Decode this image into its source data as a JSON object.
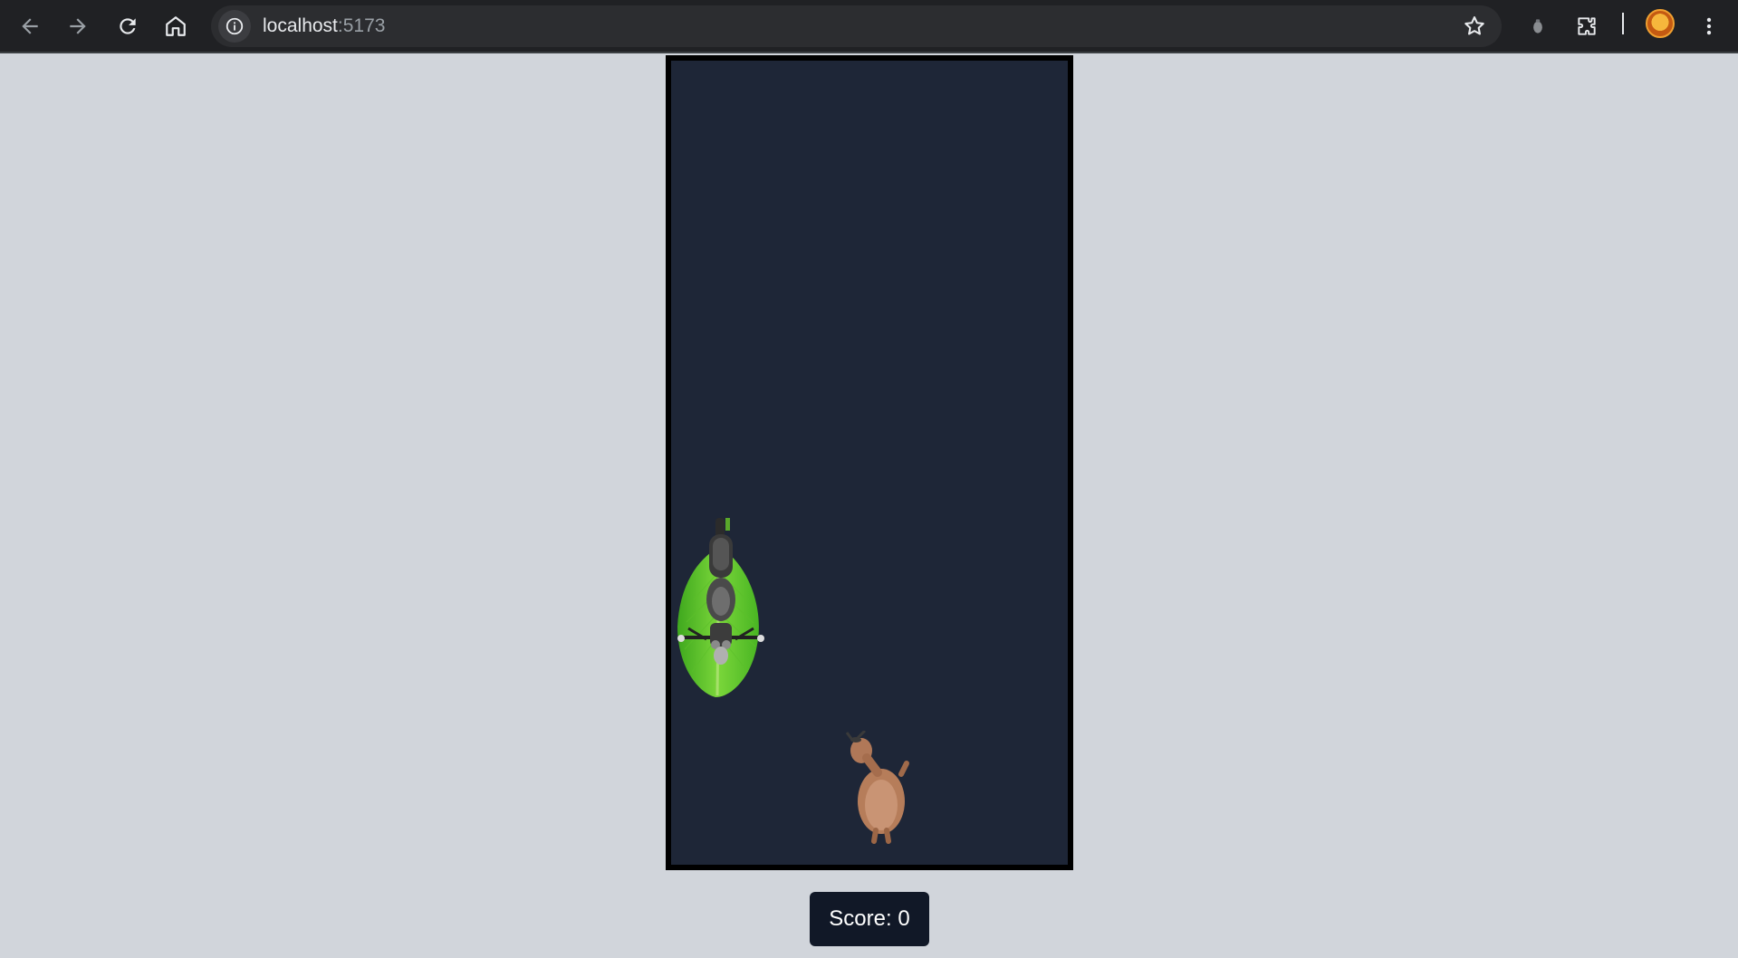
{
  "browser": {
    "url_host": "localhost",
    "url_port": ":5173"
  },
  "game": {
    "sprites": {
      "player": "motorbike-sprite",
      "pickup": "banana-leaf-sprite",
      "obstacle": "goat-sprite"
    }
  },
  "score": {
    "label": "Score: 0"
  },
  "colors": {
    "page_bg": "#d1d5db",
    "board_bg": "#1e2637",
    "board_border": "#000000",
    "score_bg": "#111827"
  }
}
